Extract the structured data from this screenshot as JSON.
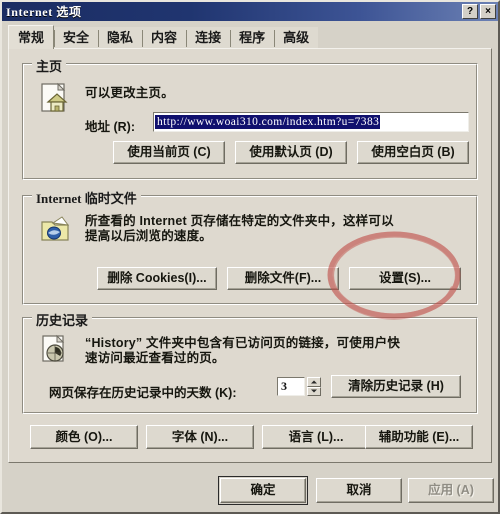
{
  "window": {
    "title": "Internet 选项",
    "help_button": "?",
    "close_button": "×",
    "titlebar_color": "#1b2d63",
    "face_color": "#ded9cf"
  },
  "tabs": [
    {
      "label": "常规",
      "active": true
    },
    {
      "label": "安全",
      "active": false
    },
    {
      "label": "隐私",
      "active": false
    },
    {
      "label": "内容",
      "active": false
    },
    {
      "label": "连接",
      "active": false
    },
    {
      "label": "程序",
      "active": false
    },
    {
      "label": "高级",
      "active": false
    }
  ],
  "home_page": {
    "group_title": "主页",
    "icon": "home-page-icon",
    "description": "可以更改主页。",
    "address_label": "地址 (R):",
    "address_value": "http://www.woai310.com/index.htm?u=7383",
    "buttons": [
      {
        "label": "使用当前页 (C)"
      },
      {
        "label": "使用默认页 (D)"
      },
      {
        "label": "使用空白页 (B)"
      }
    ]
  },
  "temp_files": {
    "group_title": "Internet 临时文件",
    "icon": "temp-files-folder-icon",
    "description_line1": "所查看的 Internet 页存储在特定的文件夹中，这样可以",
    "description_line2": "提高以后浏览的速度。",
    "buttons": [
      {
        "label": "删除 Cookies(I)..."
      },
      {
        "label": "删除文件(F)..."
      },
      {
        "label": "设置(S)..."
      }
    ]
  },
  "history": {
    "group_title": "历史记录",
    "icon": "history-page-icon",
    "description_line1": "“History” 文件夹中包含有已访问页的链接，可使用户快",
    "description_line2": "速访问最近查看过的页。",
    "days_label": "网页保存在历史记录中的天数 (K):",
    "days_value": "3",
    "clear_button": "清除历史记录 (H)"
  },
  "option_buttons": [
    {
      "label": "颜色 (O)..."
    },
    {
      "label": "字体 (N)..."
    },
    {
      "label": "语言 (L)..."
    },
    {
      "label": "辅助功能 (E)..."
    }
  ],
  "dialog_buttons": [
    {
      "label": "确定",
      "state": "default"
    },
    {
      "label": "取消",
      "state": "normal"
    },
    {
      "label": "应用 (A)",
      "state": "disabled"
    }
  ],
  "annotation": {
    "shape": "hand-drawn-red-ellipse",
    "target": "设置(S)...",
    "color": "#c94a4a"
  }
}
